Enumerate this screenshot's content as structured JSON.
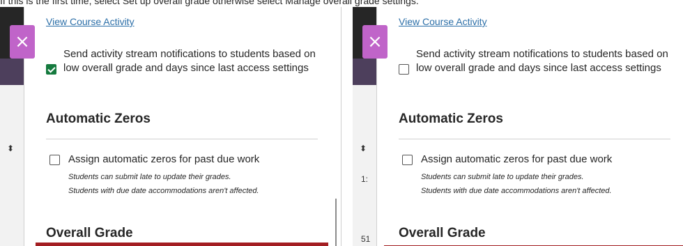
{
  "caption": "If this is the first time, select Set up overall grade otherwise select Manage overall grade settings.",
  "panels": [
    {
      "close_glyph": "×",
      "link": "View Course Activity",
      "notify": {
        "checked": true,
        "label": "Send activity stream notifications to students based on low overall grade and days since last access settings"
      },
      "automatic_zeros": {
        "title": "Automatic Zeros",
        "checked": false,
        "label": "Assign automatic zeros for past due work",
        "note_1": "Students can submit late to update their grades.",
        "note_2": "Students with due date accommodations aren't affected."
      },
      "overall_grade": {
        "title": "Overall Grade"
      },
      "edge": {
        "sort_glyph": "⬍"
      }
    },
    {
      "close_glyph": "×",
      "link": "View Course Activity",
      "notify": {
        "checked": false,
        "label": "Send activity stream notifications to students based on low overall grade and days since last access settings"
      },
      "automatic_zeros": {
        "title": "Automatic Zeros",
        "checked": false,
        "label": "Assign automatic zeros for past due work",
        "note_1": "Students can submit late to update their grades.",
        "note_2": "Students with due date accommodations aren't affected."
      },
      "overall_grade": {
        "title": "Overall Grade"
      },
      "edge": {
        "sort_glyph": "⬍",
        "text_1": "1:",
        "text_2": "51"
      }
    }
  ],
  "colors": {
    "accent_purple": "#c064c9",
    "check_green": "#157a3e",
    "link_blue": "#2c6fa8",
    "alert_red": "#a31e22"
  },
  "icons": {
    "close": "close-icon",
    "check": "checkmark-icon",
    "sort": "sort-arrows-icon"
  }
}
